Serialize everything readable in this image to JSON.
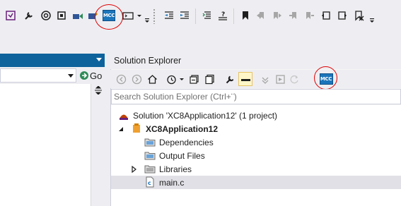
{
  "toolbar": {
    "icons": [
      "vs-icon",
      "wrench-icon",
      "target-icon",
      "chip-icon",
      "build-icon",
      "program-icon",
      "mcc-icon",
      "console-icon",
      "uncomment-icon",
      "indent-left-icon",
      "indent-right-icon",
      "comment-icon",
      "help-icon",
      "bookmark-icon",
      "prev-bookmark-icon",
      "next-bookmark-icon",
      "prev-in-file-icon",
      "next-in-file-icon",
      "bookmark-folder-icon",
      "clear-bookmarks-icon"
    ],
    "mcc_label": "MCC"
  },
  "left_pane": {
    "go_label": "Go",
    "combo_value": ""
  },
  "solution_explorer": {
    "title": "Solution Explorer",
    "search_placeholder": "Search Solution Explorer (Ctrl+¨)",
    "mcc_label": "MCC",
    "tree": [
      {
        "label": "Solution 'XC8Application12' (1 project)",
        "icon": "solution-icon",
        "expander": ""
      },
      {
        "label": "XC8Application12",
        "icon": "project-icon",
        "expander": "expanded",
        "bold": true
      },
      {
        "label": "Dependencies",
        "icon": "folder-icon",
        "expander": ""
      },
      {
        "label": "Output Files",
        "icon": "folder-icon",
        "expander": ""
      },
      {
        "label": "Libraries",
        "icon": "folder-icon",
        "expander": "collapsed"
      },
      {
        "label": "main.c",
        "icon": "c-file-icon",
        "expander": "",
        "selected": true
      }
    ]
  },
  "colors": {
    "accent_blue": "#0e639c",
    "mcc_blue": "#1b75bb",
    "highlight_circle": "#e00000"
  }
}
